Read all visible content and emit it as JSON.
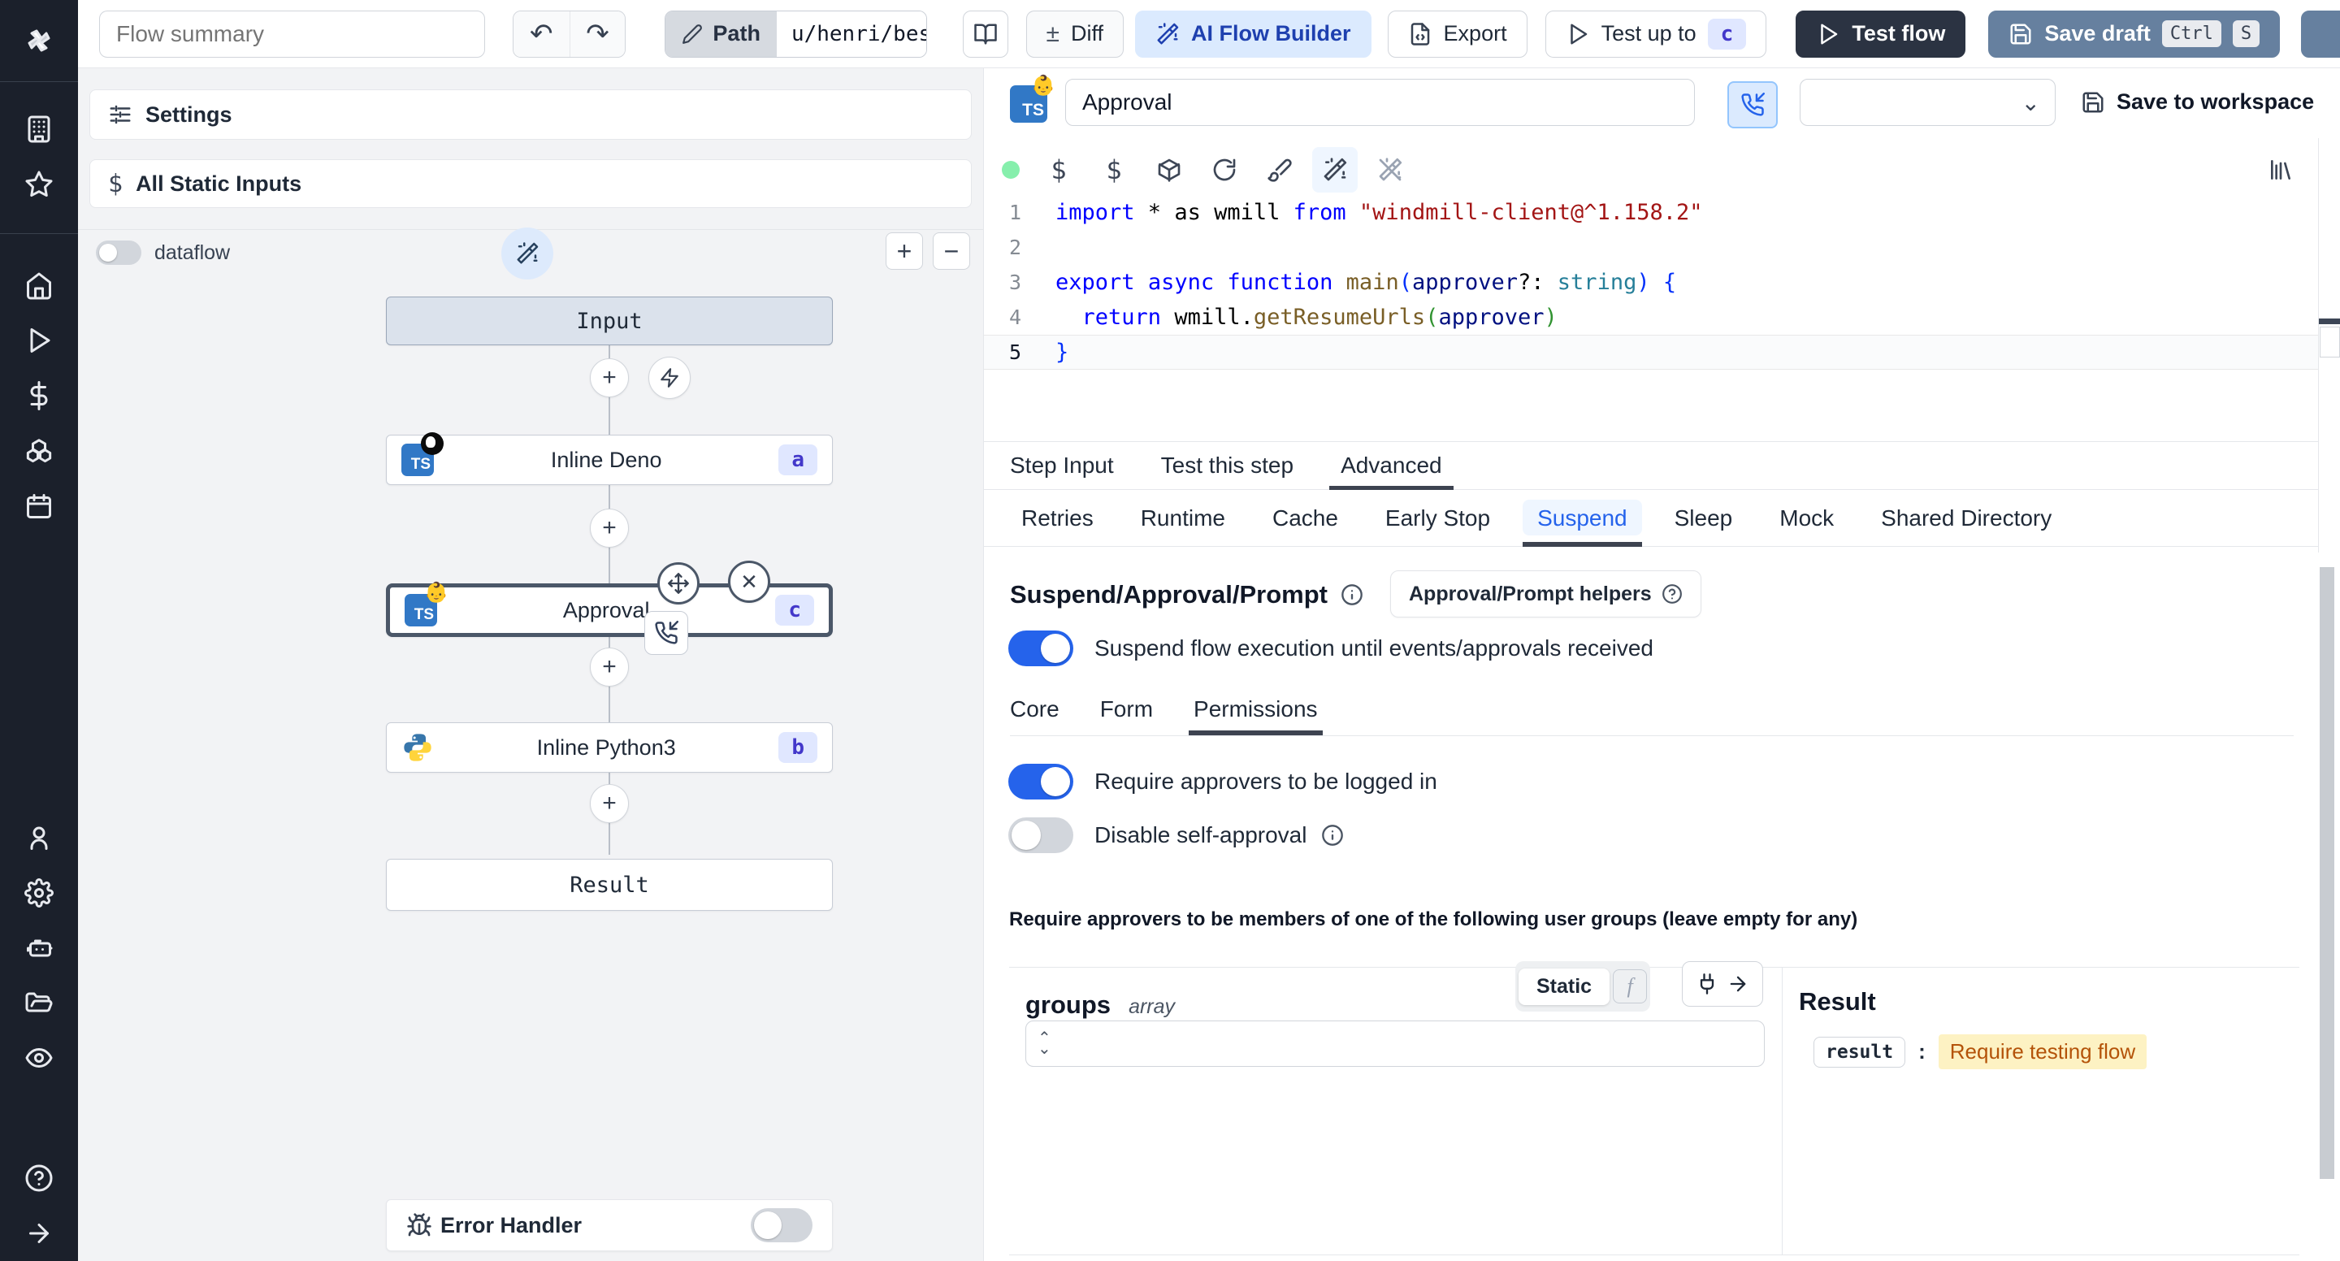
{
  "icons": {
    "ts": "TS",
    "approval_emoji": "👶",
    "dollar": "$",
    "plus": "+",
    "minus": "−",
    "diff_sign": "±",
    "close": "✕",
    "chevron_up": "⌃",
    "chevron_down": "⌄",
    "fn": "f",
    "undo": "↶",
    "redo": "↷"
  },
  "topbar": {
    "flow_summary_placeholder": "Flow summary",
    "path_label": "Path",
    "path_value": "u/henri/bes",
    "diff_label": "Diff",
    "ai_flow_builder_label": "AI Flow Builder",
    "export_label": "Export",
    "test_up_to_label": "Test up to",
    "test_up_to_badge": "c",
    "test_flow_label": "Test flow",
    "save_draft_label": "Save draft",
    "kbd_ctrl": "Ctrl",
    "kbd_s": "S"
  },
  "flow_panel": {
    "settings_label": "Settings",
    "all_static_inputs_label": "All Static Inputs",
    "dataflow_label": "dataflow",
    "nodes": {
      "input": "Input",
      "inline_deno": {
        "label": "Inline Deno",
        "badge": "a"
      },
      "approval": {
        "label": "Approval",
        "badge": "c"
      },
      "inline_python": {
        "label": "Inline Python3",
        "badge": "b"
      },
      "result": "Result"
    },
    "error_handler_label": "Error Handler"
  },
  "editor": {
    "title_value": "Approval",
    "save_to_workspace_label": "Save to workspace",
    "code": {
      "lines": [
        {
          "num": "1",
          "active": false,
          "tokens": [
            [
              "import",
              "kw"
            ],
            [
              " * as wmill ",
              "pl"
            ],
            [
              "from",
              "kw"
            ],
            [
              " ",
              "pl"
            ],
            [
              "\"windmill-client@^1.158.2\"",
              "str"
            ]
          ]
        },
        {
          "num": "2",
          "active": false,
          "tokens": []
        },
        {
          "num": "3",
          "active": false,
          "tokens": [
            [
              "export",
              "kw"
            ],
            [
              " ",
              "pl"
            ],
            [
              "async",
              "kw"
            ],
            [
              " ",
              "pl"
            ],
            [
              "function",
              "kw"
            ],
            [
              " ",
              "pl"
            ],
            [
              "main",
              "fn"
            ],
            [
              "(",
              "p1"
            ],
            [
              "approver",
              "vr"
            ],
            [
              "?:",
              "pl"
            ],
            [
              " ",
              "pl"
            ],
            [
              "string",
              "ty"
            ],
            [
              ")",
              "p1"
            ],
            [
              " {",
              "p1"
            ]
          ]
        },
        {
          "num": "4",
          "active": false,
          "tokens": [
            [
              "  ",
              "pl"
            ],
            [
              "return",
              "kw"
            ],
            [
              " wmill.",
              "pl"
            ],
            [
              "getResumeUrls",
              "fn"
            ],
            [
              "(",
              "p2"
            ],
            [
              "approver",
              "vr"
            ],
            [
              ")",
              "p2"
            ]
          ]
        },
        {
          "num": "5",
          "active": true,
          "tokens": [
            [
              "}",
              "p1"
            ]
          ]
        }
      ]
    }
  },
  "tabs": {
    "step": [
      "Step Input",
      "Test this step",
      "Advanced"
    ],
    "advanced": [
      "Retries",
      "Runtime",
      "Cache",
      "Early Stop",
      "Suspend",
      "Sleep",
      "Mock",
      "Shared Directory"
    ],
    "suspend_sub": [
      "Core",
      "Form",
      "Permissions"
    ]
  },
  "suspend": {
    "heading": "Suspend/Approval/Prompt",
    "helpers_button": "Approval/Prompt helpers",
    "suspend_toggle_label": "Suspend flow execution until events/approvals received",
    "require_logged_in_label": "Require approvers to be logged in",
    "disable_self_approval_label": "Disable self-approval",
    "groups_note": "Require approvers to be members of one of the following user groups (leave empty for any)",
    "groups_label": "groups",
    "groups_type": "array",
    "static_label": "Static",
    "result_heading": "Result",
    "result_key": "result",
    "result_separator": ":",
    "result_value": "Require testing flow"
  }
}
